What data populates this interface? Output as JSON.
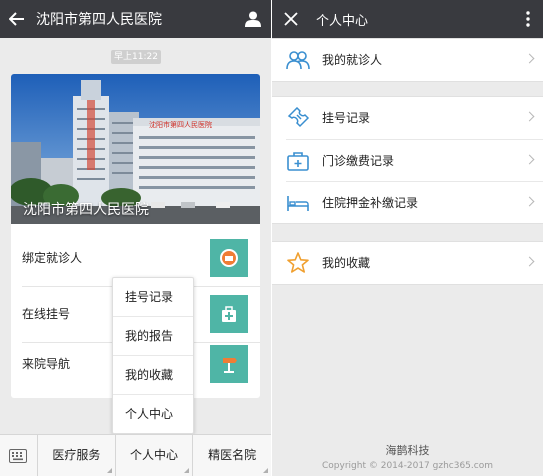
{
  "left_screen": {
    "title": "沈阳市第四人民医院",
    "timestamp": "早上11:22",
    "hero_caption": "沈阳市第四人民医院",
    "hero_building_sign": "沈阳市第四人民医院",
    "rows": [
      {
        "label": "绑定就诊人",
        "icon": "id-badge-icon"
      },
      {
        "label": "在线挂号",
        "icon": "medical-bag-icon"
      },
      {
        "label": "来院导航",
        "icon": "signpost-icon"
      }
    ],
    "popup_menu": [
      "挂号记录",
      "我的报告",
      "我的收藏",
      "个人中心"
    ],
    "bottom_menu": [
      "医疗服务",
      "个人中心",
      "精医名院"
    ],
    "accent_color": "#4fb5a6"
  },
  "right_screen": {
    "title": "个人中心",
    "groups": [
      {
        "items": [
          {
            "label": "我的就诊人",
            "icon": "people-icon"
          }
        ]
      },
      {
        "items": [
          {
            "label": "挂号记录",
            "icon": "ticket-icon"
          },
          {
            "label": "门诊缴费记录",
            "icon": "medical-kit-icon"
          },
          {
            "label": "住院押金补缴记录",
            "icon": "hospital-bed-icon"
          }
        ]
      },
      {
        "items": [
          {
            "label": "我的收藏",
            "icon": "star-icon"
          }
        ]
      }
    ],
    "footer_name": "海鹊科技",
    "footer_copyright": "Copyright © 2014-2017 gzhc365.com",
    "icon_color": "#3a8fd0",
    "star_color": "#f0a030"
  }
}
